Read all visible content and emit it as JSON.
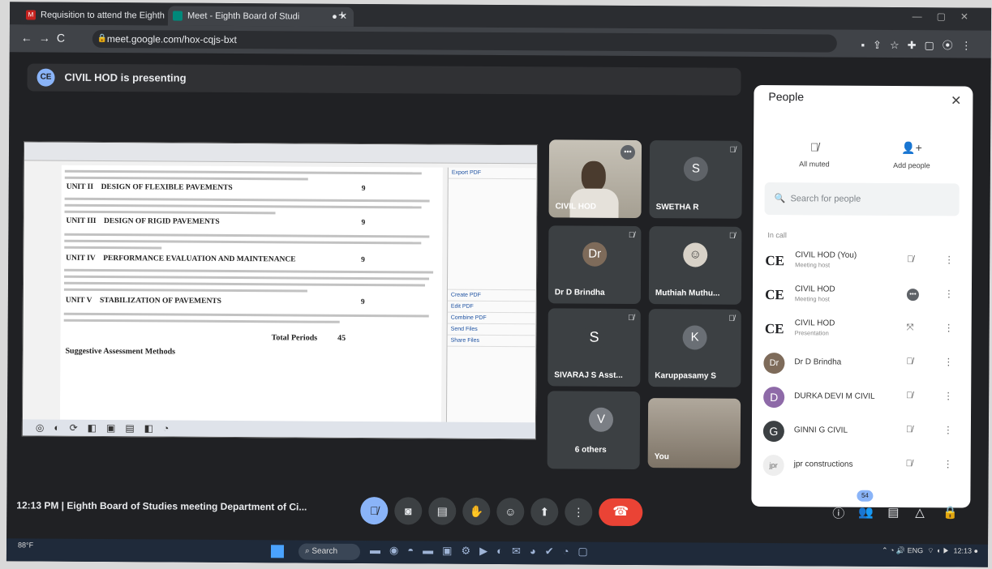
{
  "browser": {
    "tab1_title": "Requisition to attend the Eighth",
    "tab2_title": "Meet - Eighth Board of Studi",
    "url": "meet.google.com/hox-cqjs-bxt"
  },
  "presenting_banner": "CIVIL HOD is presenting",
  "shared_doc": {
    "units": [
      {
        "label": "UNIT II",
        "title": "DESIGN OF FLEXIBLE PAVEMENTS",
        "hours": "9"
      },
      {
        "label": "UNIT III",
        "title": "DESIGN OF RIGID PAVEMENTS",
        "hours": "9"
      },
      {
        "label": "UNIT IV",
        "title": "PERFORMANCE EVALUATION AND MAINTENANCE",
        "hours": "9"
      },
      {
        "label": "UNIT V",
        "title": "STABILIZATION OF PAVEMENTS",
        "hours": "9"
      }
    ],
    "total_label": "Total Periods",
    "total_value": "45",
    "assessment_heading": "Suggestive Assessment Methods",
    "side_pane": [
      "Export PDF",
      "Create PDF",
      "Edit PDF",
      "Combine PDF",
      "Send Files",
      "Share Files"
    ]
  },
  "tiles": [
    {
      "name": "CIVIL HOD",
      "kind": "photo"
    },
    {
      "name": "SWETHA R",
      "initial": "S",
      "color": "#5f6368"
    },
    {
      "name": "Dr D Brindha",
      "initial": "Dr",
      "color": "#7e6b5a"
    },
    {
      "name": "Muthiah Muthu...",
      "kind": "photo"
    },
    {
      "name": "SIVARAJ S Asst...",
      "initial": "S",
      "color": "#3c4043"
    },
    {
      "name": "Karuppasamy S",
      "initial": "K",
      "color": "#6a6f75"
    },
    {
      "name": "6 others",
      "initial": "V",
      "color": "#7b7f85"
    },
    {
      "name": "You",
      "kind": "photo"
    }
  ],
  "people_panel": {
    "title": "People",
    "all_muted": "All muted",
    "add_people": "Add people",
    "search_placeholder": "Search for people",
    "in_call_label": "In call",
    "participants": [
      {
        "avatar": "CE",
        "name": "CIVIL HOD (You)",
        "sub": "Meeting host",
        "state": "muted"
      },
      {
        "avatar": "CE",
        "name": "CIVIL HOD",
        "sub": "Meeting host",
        "state": "speaking"
      },
      {
        "avatar": "CE",
        "name": "CIVIL HOD",
        "sub": "Presentation",
        "state": "muted"
      },
      {
        "avatar": "Dr",
        "name": "Dr D Brindha",
        "sub": "",
        "state": "muted"
      },
      {
        "avatar": "D",
        "name": "DURKA DEVI M CIVIL",
        "sub": "",
        "state": "muted"
      },
      {
        "avatar": "G",
        "name": "GINNI G CIVIL",
        "sub": "",
        "state": "muted"
      },
      {
        "avatar": "jpr",
        "name": "jpr constructions",
        "sub": "",
        "state": "muted"
      }
    ]
  },
  "meeting_info": "12:13 PM | Eighth Board of Studies meeting Department of Ci...",
  "participant_count": "54",
  "taskbar": {
    "weather": "88°F",
    "search": "Search",
    "lang": "ENG",
    "clock": "12:13"
  }
}
